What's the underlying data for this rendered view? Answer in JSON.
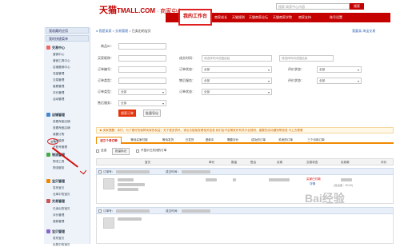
{
  "header": {
    "logo_text": "天猫",
    "logo_domain": "TMALL.COM",
    "logo_sub": "· 商家中心",
    "search_placeholder": "搜索 商家中心内容",
    "search_button": "搜索",
    "nav_active": "我的工作台",
    "nav_items": [
      "商家成长",
      "天猫规则",
      "天猫商家论坛",
      "天猫商家学院",
      "商家支持",
      "账号设置"
    ]
  },
  "sidebar": {
    "top_links": [
      "我收藏的应用",
      "我的快捷菜单"
    ],
    "sections": [
      {
        "title": "交易中心",
        "items": [
          "营销中心",
          "营销工具中心",
          "店铺营销中心",
          "流量管理",
          "交易管理",
          "客服管理",
          "评价管理",
          "活动管理"
        ]
      },
      {
        "title": "店铺管理",
        "items": [
          "查看淘宝店铺",
          "查看淘宝店铺",
          "我要订购",
          "店铺装修",
          "子账号管理"
        ]
      },
      {
        "title": "物流管理",
        "items": [
          "发货",
          "物流工具",
          "物流服务"
        ]
      },
      {
        "title": "宝贝管理",
        "items": [
          "发布宝贝",
          "仓库中的宝贝"
        ]
      },
      {
        "title": "交易管理",
        "items": [
          "已卖出的宝贝",
          "评价管理",
          "退款管理"
        ]
      },
      {
        "title": "宝贝管理",
        "items": [
          "发布宝贝",
          "出售中的宝贝"
        ]
      }
    ]
  },
  "breadcrumb": {
    "home": "我是卖家",
    "sep": ">",
    "mid": "交易管理",
    "current": "已卖出的宝贝"
  },
  "breadcrumb_right": "我要卖-淘宝交易",
  "filters": {
    "product_name_label": "商品ID：",
    "buyer_nick_label": "买家昵称：",
    "order_no_label": "订单编号：",
    "order_status_label": "订单状态：",
    "eval_label": "评价状态：",
    "order_type_label": "订单类型：",
    "refund_label": "售后服务：",
    "time_label": "成交时间：",
    "time_start_placeholder": "请选择时间范围起始",
    "time_end_placeholder": "请选择时间范围结束",
    "all": "全部",
    "search_button": "搜索订单",
    "export_button": "批量导出"
  },
  "notice": "★ 卖家提醒：亲们，为了更好的保障卖家的权益！关于更多资讯，请点击链接查看相关信息    我们会不定期发布有关平台规则、重要的活动通知等信息  马上去看看",
  "tabs": [
    "近三个月订单",
    "等待买家付款",
    "等待发货",
    "已发货",
    "退款中",
    "需要评价",
    "成功的订单",
    "关闭的订单",
    "三个月前订单"
  ],
  "toolbar": {
    "select_all": "全选",
    "batch_mark": "批量标记",
    "hide_flag": "不显示已关闭的订单"
  },
  "table_headers": [
    "宝贝",
    "单价",
    "数量",
    "售后",
    "买家",
    "交易状态",
    "实收款",
    "评价"
  ],
  "order": {
    "order_no_label": "订单号：",
    "time_label": "成交时间：",
    "status": "买家已付款",
    "detail": "详情",
    "total_hint": "(含运费：¥0.00)"
  },
  "order2": {
    "order_no_label": "订单号：",
    "time_label": "成交时间："
  },
  "watermark": "Bai经验"
}
